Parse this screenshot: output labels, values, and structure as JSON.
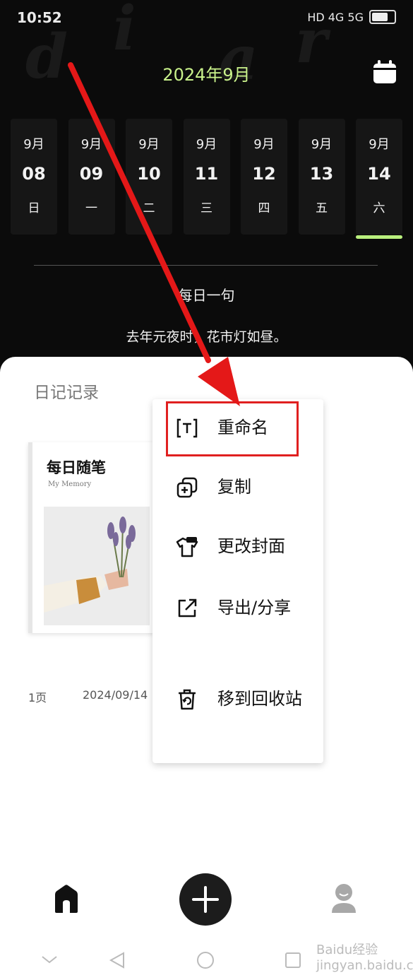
{
  "status": {
    "time": "10:52",
    "icons_text": "HD 4G 5G",
    "battery": "battery-icon"
  },
  "header": {
    "month": "2024年9月",
    "calendar_icon": "calendar-icon"
  },
  "background_letters": [
    "d",
    "i",
    "a",
    "r"
  ],
  "days": [
    {
      "month": "9月",
      "day": "08",
      "week": "日"
    },
    {
      "month": "9月",
      "day": "09",
      "week": "一"
    },
    {
      "month": "9月",
      "day": "10",
      "week": "二"
    },
    {
      "month": "9月",
      "day": "11",
      "week": "三"
    },
    {
      "month": "9月",
      "day": "12",
      "week": "四"
    },
    {
      "month": "9月",
      "day": "13",
      "week": "五"
    },
    {
      "month": "9月",
      "day": "14",
      "week": "六"
    }
  ],
  "quote": {
    "title": "每日一句",
    "text": "去年元夜时，花市灯如昼。"
  },
  "sheet": {
    "title": "日记记录"
  },
  "book": {
    "title": "每日随笔",
    "subtitle": "My Memory",
    "pages": "1页",
    "date": "2024/09/14"
  },
  "menu": {
    "items": [
      {
        "label": "重命名",
        "icon": "rename-icon"
      },
      {
        "label": "复制",
        "icon": "copy-icon"
      },
      {
        "label": "更改封面",
        "icon": "cover-shirt-icon"
      },
      {
        "label": "导出/分享",
        "icon": "share-icon"
      },
      {
        "label": "移到回收站",
        "icon": "trash-icon"
      }
    ]
  },
  "nav": {
    "home": "home-icon",
    "add": "plus-icon",
    "profile": "user-icon"
  },
  "watermark": "Baidu经验 jingyan.baidu.com",
  "colors": {
    "accent": "#c9f28b",
    "highlight": "#e02020",
    "arrow": "#e41818"
  }
}
